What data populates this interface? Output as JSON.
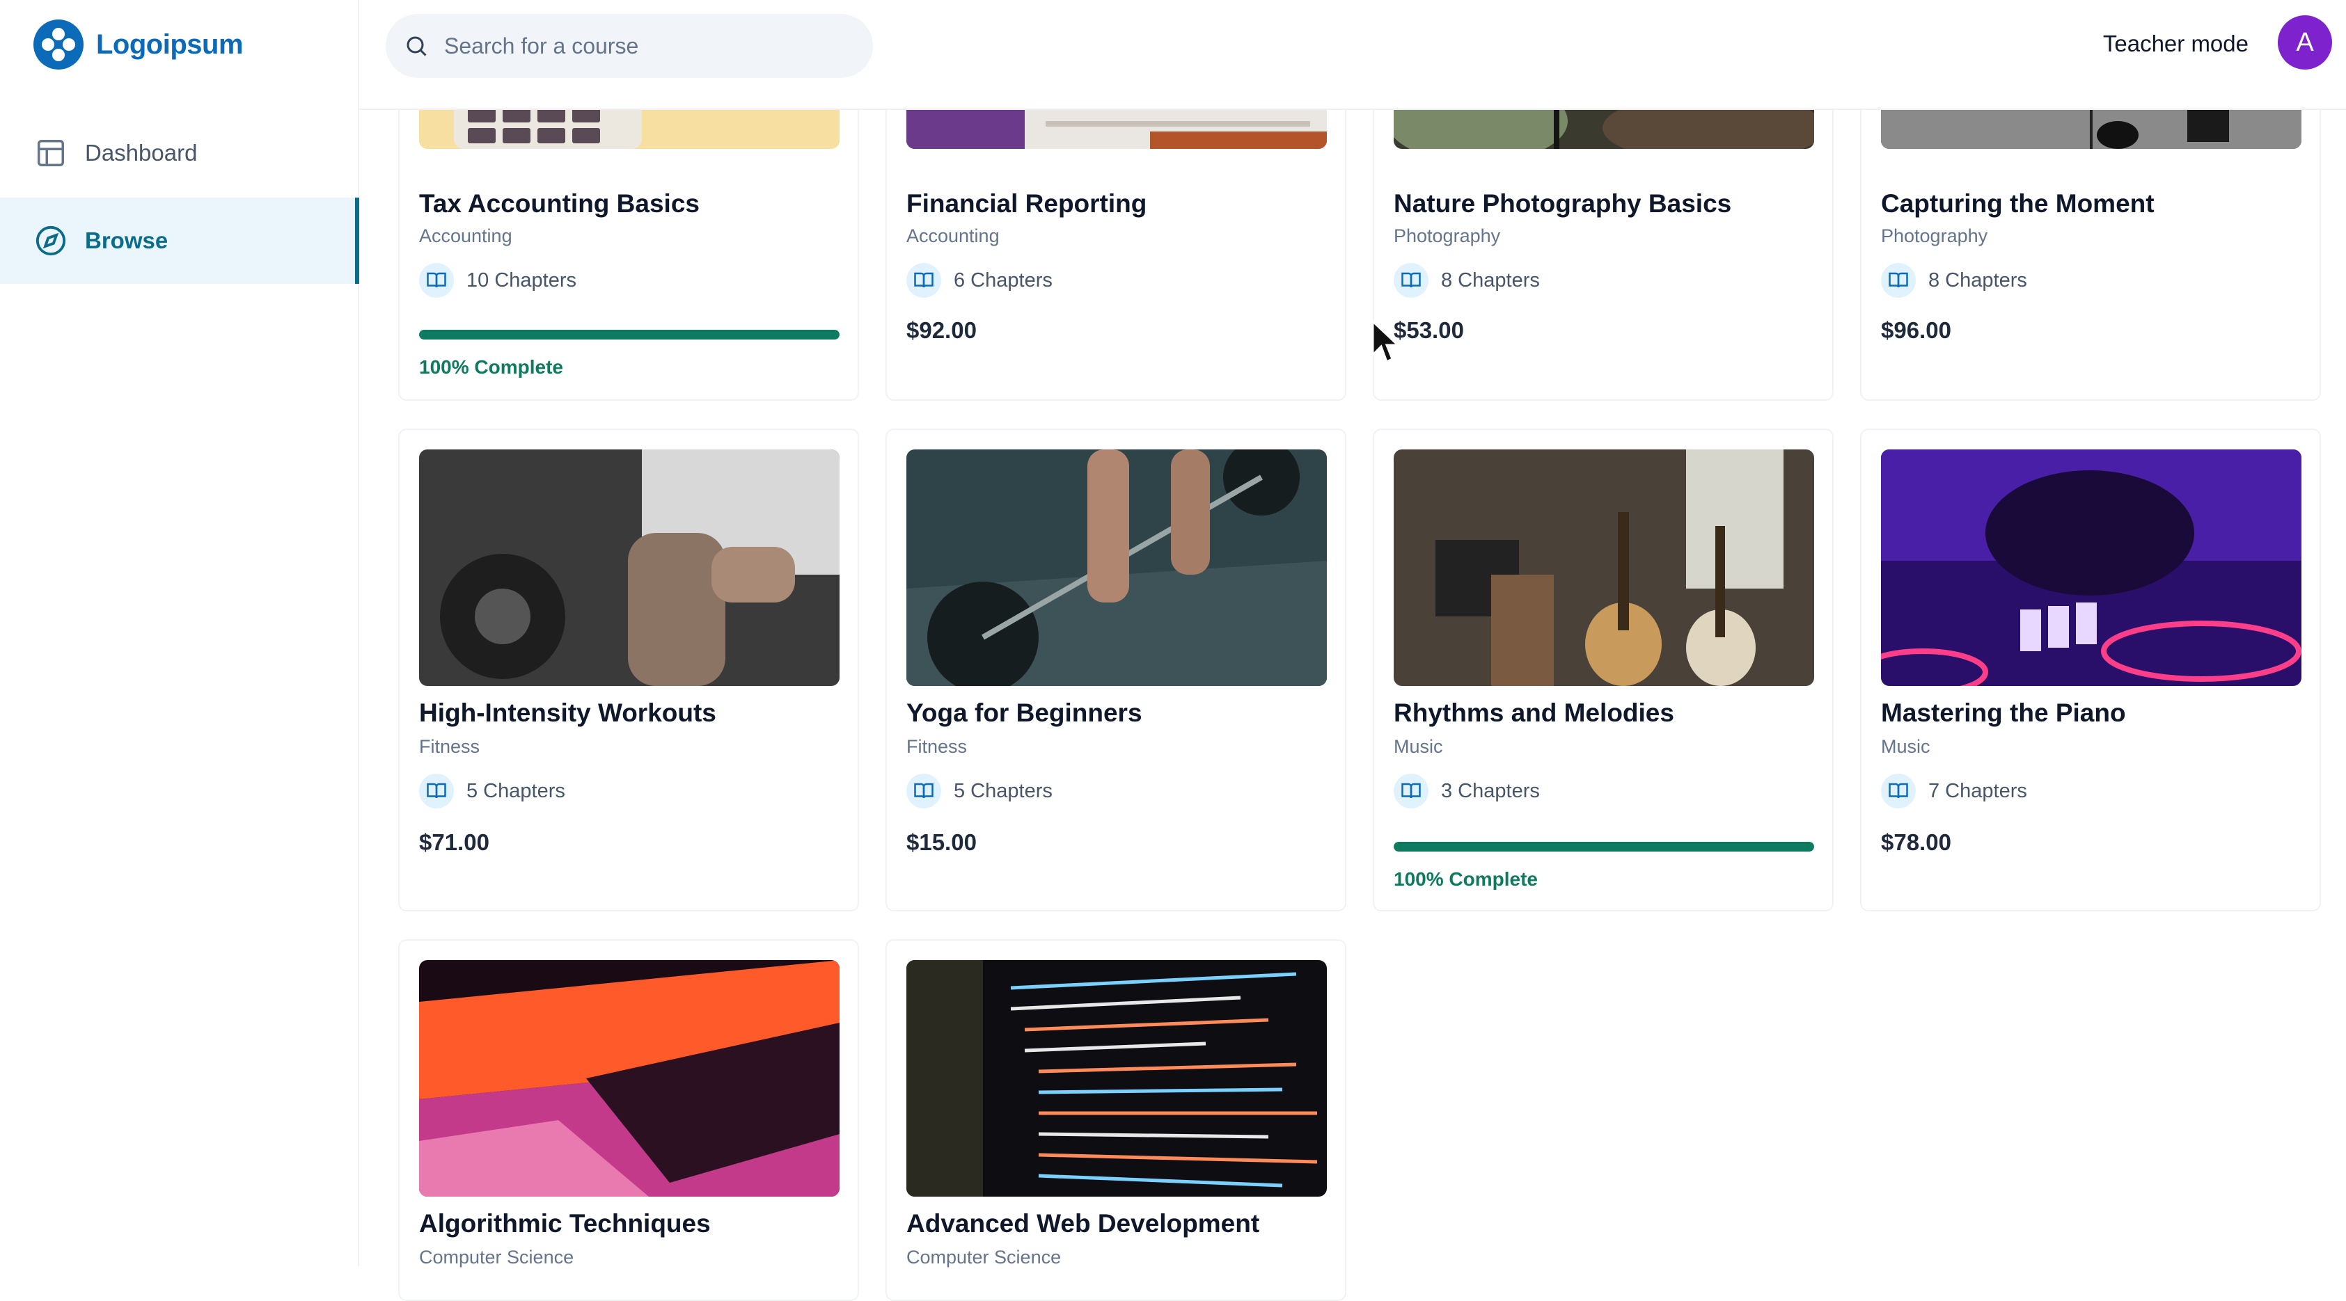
{
  "brand": {
    "name": "Logoipsum"
  },
  "sidebar": {
    "items": [
      {
        "label": "Dashboard",
        "icon": "layout-icon"
      },
      {
        "label": "Browse",
        "icon": "compass-icon",
        "active": true
      }
    ]
  },
  "header": {
    "search_placeholder": "Search for a course",
    "teacher_mode_label": "Teacher mode",
    "avatar_initial": "A"
  },
  "colors": {
    "accent": "#0b6b8a",
    "progress": "#0e7a5f",
    "avatar": "#7e22ce"
  },
  "courses": [
    {
      "title": "Tax Accounting Basics",
      "category": "Accounting",
      "chapters": "10 Chapters",
      "progress_label": "100% Complete",
      "progress": 1.0
    },
    {
      "title": "Financial Reporting",
      "category": "Accounting",
      "chapters": "6 Chapters",
      "price": "$92.00"
    },
    {
      "title": "Nature Photography Basics",
      "category": "Photography",
      "chapters": "8 Chapters",
      "price": "$53.00"
    },
    {
      "title": "Capturing the Moment",
      "category": "Photography",
      "chapters": "8 Chapters",
      "price": "$96.00"
    },
    {
      "title": "High-Intensity Workouts",
      "category": "Fitness",
      "chapters": "5 Chapters",
      "price": "$71.00"
    },
    {
      "title": "Yoga for Beginners",
      "category": "Fitness",
      "chapters": "5 Chapters",
      "price": "$15.00"
    },
    {
      "title": "Rhythms and Melodies",
      "category": "Music",
      "chapters": "3 Chapters",
      "progress_label": "100% Complete",
      "progress": 1.0
    },
    {
      "title": "Mastering the Piano",
      "category": "Music",
      "chapters": "7 Chapters",
      "price": "$78.00"
    },
    {
      "title": "Algorithmic Techniques",
      "category": "Computer Science"
    },
    {
      "title": "Advanced Web Development",
      "category": "Computer Science"
    }
  ]
}
